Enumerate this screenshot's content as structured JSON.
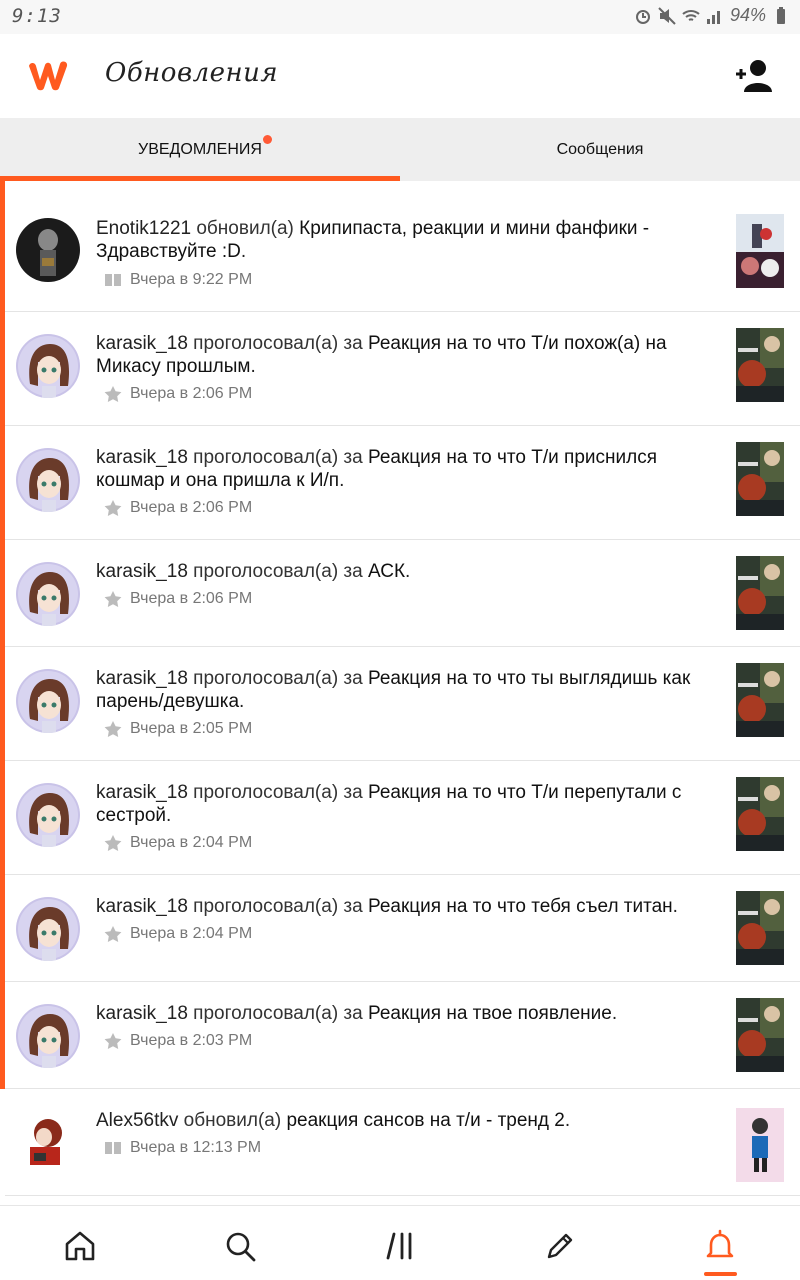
{
  "status": {
    "time": "9:13",
    "battery": "94%"
  },
  "header": {
    "title": "Обновления"
  },
  "tabs": [
    {
      "label": "УВЕДОМЛЕНИЯ",
      "active": true,
      "has_dot": true
    },
    {
      "label": "Сообщения",
      "active": false,
      "has_dot": false
    }
  ],
  "items": [
    {
      "user": "Enotik1221",
      "verb": " обновил(а) ",
      "title": "Крипипаста, реакции и мини фанфики - Здравствуйте :D",
      "tail": ".",
      "time": "Вчера в 9:22 PM",
      "icon": "book-icon"
    },
    {
      "user": "karasik_18",
      "verb": " проголосовал(а) за ",
      "title": "Реакция на то что Т/и похож(а) на Микасу прошлым",
      "tail": ".",
      "time": "Вчера в 2:06 PM",
      "icon": "star-icon"
    },
    {
      "user": "karasik_18",
      "verb": " проголосовал(а) за ",
      "title": "Реакция на то что Т/и приснился кошмар и она пришла к И/п",
      "tail": ".",
      "time": "Вчера в 2:06 PM",
      "icon": "star-icon"
    },
    {
      "user": "karasik_18",
      "verb": " проголосовал(а) за ",
      "title": "АСК",
      "tail": ".",
      "time": "Вчера в 2:06 PM",
      "icon": "star-icon"
    },
    {
      "user": "karasik_18",
      "verb": " проголосовал(а) за ",
      "title": "Реакция на то что ты выглядишь как парень/девушка",
      "tail": ".",
      "time": "Вчера в 2:05 PM",
      "icon": "star-icon"
    },
    {
      "user": "karasik_18",
      "verb": " проголосовал(а) за ",
      "title": "Реакция на то что Т/и перепутали с сестрой",
      "tail": ".",
      "time": "Вчера в 2:04 PM",
      "icon": "star-icon"
    },
    {
      "user": "karasik_18",
      "verb": " проголосовал(а) за ",
      "title": "Реакция на то что тебя съел титан",
      "tail": ".",
      "time": "Вчера в 2:04 PM",
      "icon": "star-icon"
    },
    {
      "user": "karasik_18",
      "verb": " проголосовал(а) за ",
      "title": "Реакция на твое появление",
      "tail": ".",
      "time": "Вчера в 2:03 PM",
      "icon": "star-icon"
    },
    {
      "user": "Alex56tkv",
      "verb": " обновил(а) ",
      "title": "реакция сансов на т/и - тренд 2",
      "tail": ".",
      "time": "Вчера в 12:13 PM",
      "icon": "book-icon"
    }
  ],
  "bottom_nav": [
    {
      "name": "home-icon",
      "active": false
    },
    {
      "name": "search-icon",
      "active": false
    },
    {
      "name": "library-icon",
      "active": false
    },
    {
      "name": "pencil-icon",
      "active": false
    },
    {
      "name": "bell-icon",
      "active": true
    }
  ],
  "colors": {
    "accent": "#ff5a1f",
    "tab_bg": "#eeeeee"
  }
}
